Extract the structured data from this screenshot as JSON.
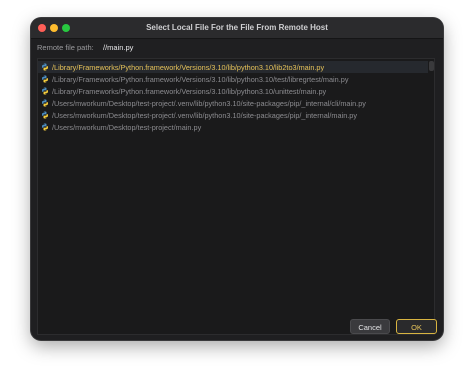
{
  "window": {
    "title": "Select Local File For the File From Remote Host"
  },
  "remote_path": {
    "label": "Remote file path:",
    "value": "//main.py"
  },
  "file_list": {
    "items": [
      {
        "path": "/Library/Frameworks/Python.framework/Versions/3.10/lib/python3.10/lib2to3/main.py",
        "selected": true,
        "icon": "python-file-icon"
      },
      {
        "path": "/Library/Frameworks/Python.framework/Versions/3.10/lib/python3.10/test/libregrtest/main.py",
        "selected": false,
        "icon": "python-file-icon"
      },
      {
        "path": "/Library/Frameworks/Python.framework/Versions/3.10/lib/python3.10/unittest/main.py",
        "selected": false,
        "icon": "python-file-icon"
      },
      {
        "path": "/Users/mworkum/Desktop/test-project/.venv/lib/python3.10/site-packages/pip/_internal/cli/main.py",
        "selected": false,
        "icon": "python-file-icon"
      },
      {
        "path": "/Users/mworkum/Desktop/test-project/.venv/lib/python3.10/site-packages/pip/_internal/main.py",
        "selected": false,
        "icon": "python-file-icon"
      },
      {
        "path": "/Users/mworkum/Desktop/test-project/main.py",
        "selected": false,
        "icon": "python-file-icon"
      }
    ]
  },
  "buttons": {
    "cancel": "Cancel",
    "ok": "OK"
  },
  "colors": {
    "accent": "#d8b441",
    "selected_text": "#e6c35a",
    "background": "#1f1f21"
  }
}
